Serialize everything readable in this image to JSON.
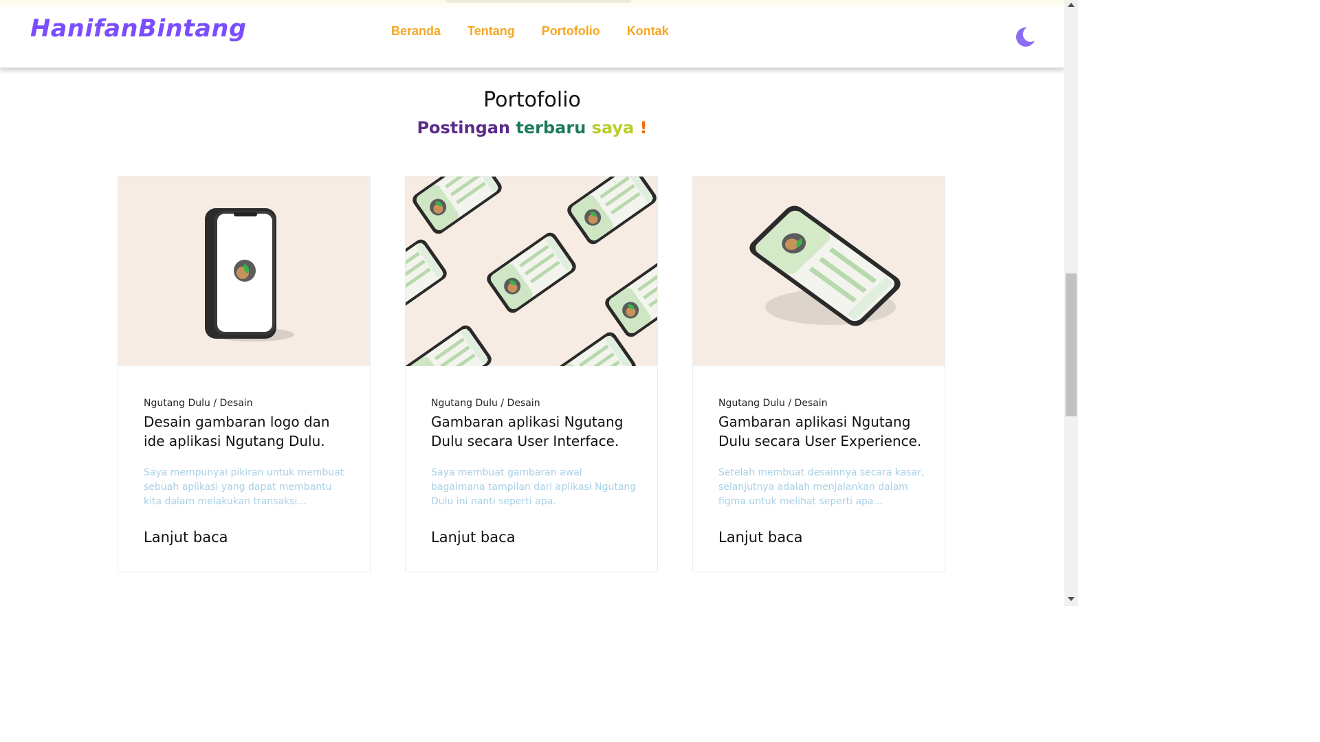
{
  "header": {
    "logo": "HanifanBintang",
    "nav": [
      "Beranda",
      "Tentang",
      "Portofolio",
      "Kontak"
    ]
  },
  "theme_toggle_icon": "moon-icon",
  "section": {
    "title": "Portofolio",
    "subtitle_words": [
      "Postingan",
      "terbaru",
      "saya",
      "!"
    ]
  },
  "colors": {
    "logo": "#7b4dff",
    "nav": "#f5a623",
    "excerpt": "#a8d0e6",
    "subtitle": [
      "#5b2b8c",
      "#1d7a5c",
      "#b9cc2a",
      "#f56a00"
    ]
  },
  "cards": [
    {
      "category": "Ngutang Dulu / Desain",
      "title": "Desain gambaran logo dan ide aplikasi Ngutang Dulu.",
      "excerpt": "Saya mempunyai pikiran untuk membuat sebuah aplikasi yang dapat membantu kita dalam melakukan transaksi...",
      "link": "Lanjut baca"
    },
    {
      "category": "Ngutang Dulu / Desain",
      "title": "Gambaran aplikasi Ngutang Dulu secara User Interface.",
      "excerpt": "Saya membuat gambaran awal bagaimana tampilan dari aplikasi Ngutang Dulu ini nanti seperti apa.",
      "link": "Lanjut baca"
    },
    {
      "category": "Ngutang Dulu / Desain",
      "title": "Gambaran aplikasi Ngutang Dulu secara User Experience.",
      "excerpt": "Setelah membuat desainnya secara kasar, selanjutnya adalah menjalankan dalam figma untuk melihat seperti apa...",
      "link": "Lanjut baca"
    }
  ]
}
